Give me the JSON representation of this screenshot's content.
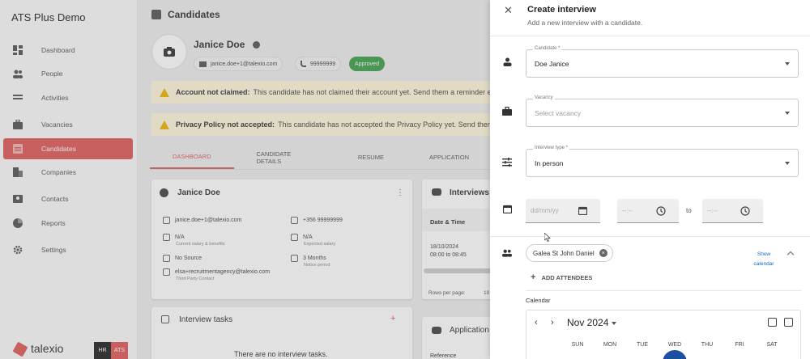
{
  "sidebar": {
    "brand": "ATS Plus Demo",
    "items": [
      {
        "label": "Dashboard",
        "icon": "dashboard-icon"
      },
      {
        "label": "People",
        "icon": "people-icon"
      },
      {
        "label": "Activities",
        "icon": "activities-icon"
      },
      {
        "label": "Vacancies",
        "icon": "briefcase-icon"
      },
      {
        "label": "Candidates",
        "icon": "candidates-icon"
      },
      {
        "label": "Companies",
        "icon": "companies-icon"
      },
      {
        "label": "Contacts",
        "icon": "contacts-icon"
      },
      {
        "label": "Reports",
        "icon": "reports-icon"
      },
      {
        "label": "Settings",
        "icon": "gear-icon"
      }
    ],
    "logo_text": "talexio",
    "hr": "HR",
    "ats": "ATS",
    "accent": "#e05a5a"
  },
  "main": {
    "title": "Candidates",
    "candidate_name": "Janice Doe",
    "email_chip": "janice.doe+1@talexio.com",
    "phone_chip": "99999999",
    "status_chip": "Approved",
    "banners": [
      {
        "bold": "Account not claimed:",
        "text": "This candidate has not claimed their account yet. Send them a reminder e"
      },
      {
        "bold": "Privacy Policy not accepted:",
        "text": "This candidate has not accepted the Privacy Policy yet. Send them"
      }
    ],
    "tabs": [
      "DASHBOARD",
      "CANDIDATE DETAILS",
      "RESUME",
      "APPLICATION"
    ],
    "profile_card": {
      "name": "Janice Doe",
      "email": "janice.doe+1@talexio.com",
      "phone": "+356 99999999",
      "salary": "N/A",
      "salary_sub": "Current salary & benefits",
      "expected": "N/A",
      "expected_sub": "Expected salary",
      "source": "No Source",
      "notice": "3 Months",
      "notice_sub": "Notice period",
      "contact": "elsa+recruitmentagency@talexio.com",
      "contact_sub": "Third Party Contact"
    },
    "interviews_card": {
      "title": "Interviews",
      "col": "Date & Time",
      "date": "18/10/2024",
      "time": "08:00 to 08:45",
      "rows_per_page": "Rows per page:",
      "rows_value": "10"
    },
    "tasks_card": {
      "title": "Interview tasks",
      "empty": "There are no interview tasks."
    },
    "applications_card": {
      "title": "Application",
      "col": "Reference"
    }
  },
  "drawer": {
    "title": "Create interview",
    "subtitle": "Add a new interview with a candidate.",
    "candidate": {
      "label": "Candidate *",
      "value": "Doe Janice"
    },
    "vacancy": {
      "label": "Vacancy",
      "placeholder": "Select vacancy"
    },
    "interview_type": {
      "label": "Interview type *",
      "value": "In person"
    },
    "date_placeholder": "dd/mm/yy",
    "time_placeholder": "--:--",
    "to_label": "to",
    "attendee": "Galea St John Daniel",
    "show_calendar": "Show calendar",
    "add_attendees": "ADD ATTENDEES",
    "calendar_label": "Calendar",
    "month": "Nov 2024",
    "weekdays": [
      "SUN",
      "MON",
      "TUE",
      "WED",
      "THU",
      "FRI",
      "SAT"
    ]
  }
}
